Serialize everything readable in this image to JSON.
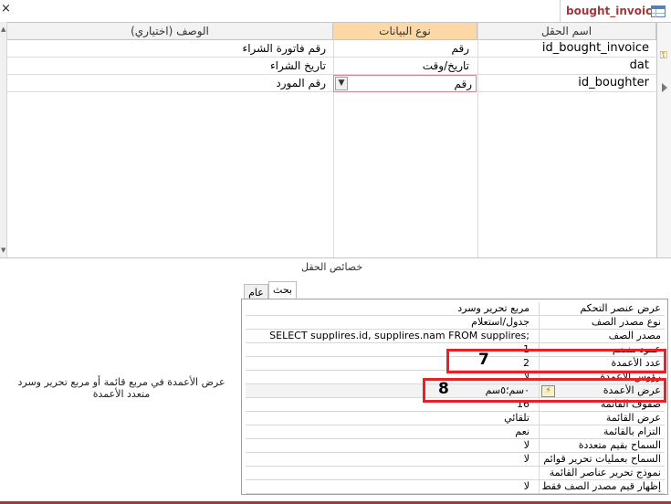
{
  "window": {
    "tab_title": "bought_invoice",
    "close_glyph": "×",
    "table_icon": "table-icon"
  },
  "grid": {
    "headers": {
      "field_name": "اسم الحقل",
      "data_type": "نوع البيانات",
      "description": "الوصف (اختياري)"
    },
    "rows": [
      {
        "field_name": "id_bought_invoice",
        "data_type": "رقم",
        "description": "رقم فاتورة الشراء",
        "is_primary_key": true
      },
      {
        "field_name": "dat",
        "data_type": "تاريخ/وقت",
        "description": "تاريخ الشراء",
        "is_primary_key": false
      },
      {
        "field_name": "id_boughter",
        "data_type": "رقم",
        "description": "رقم المورد",
        "is_primary_key": false,
        "selected": true
      }
    ]
  },
  "properties": {
    "section_title": "خصائص الحقل",
    "tabs": [
      {
        "label": "عام",
        "active": false
      },
      {
        "label": "بحث",
        "active": true
      }
    ],
    "rows": [
      {
        "label": "عرض عنصر التحكم",
        "value": "مربع تحرير وسرد"
      },
      {
        "label": "نوع مصدر الصف",
        "value": "جدول/استعلام"
      },
      {
        "label": "مصدر الصف",
        "value": "SELECT supplires.id, supplires.nam FROM supplires;"
      },
      {
        "label": "عمود منضم",
        "value": "1"
      },
      {
        "label": "عدد الأعمدة",
        "value": "2"
      },
      {
        "label": "رؤوس الأعمدة",
        "value": "لا"
      },
      {
        "label": "عرض الأعمدة",
        "value": "٠سم؛٥سم"
      },
      {
        "label": "صفوف القائمة",
        "value": "16"
      },
      {
        "label": "عرض القائمة",
        "value": "تلقائي"
      },
      {
        "label": "التزام بالقائمة",
        "value": "نعم"
      },
      {
        "label": "السماح بقيم متعددة",
        "value": "لا"
      },
      {
        "label": "السماح بعمليات تحرير قوائم",
        "value": "لا"
      },
      {
        "label": "نموذج تحرير عناصر القائمة",
        "value": ""
      },
      {
        "label": "إظهار قيم مصدر الصف فقط",
        "value": "لا"
      }
    ],
    "help_text": "عرض الأعمدة في مربع قائمة أو مربع تحرير وسرد متعدد الأعمدة"
  },
  "annotations": [
    {
      "number": "7",
      "color": "#e8202a"
    },
    {
      "number": "8",
      "color": "#e8202a"
    }
  ],
  "colors": {
    "accent": "#a4373a",
    "header_active": "#fbd8a6",
    "annotation": "#e8202a"
  }
}
